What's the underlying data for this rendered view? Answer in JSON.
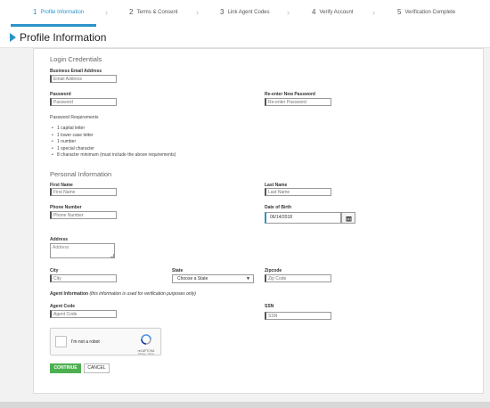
{
  "stepper": {
    "steps": [
      {
        "num": "1",
        "label": "Profile Information"
      },
      {
        "num": "2",
        "label": "Terms & Consent"
      },
      {
        "num": "3",
        "label": "Link Agent Codes"
      },
      {
        "num": "4",
        "label": "Verify Account"
      },
      {
        "num": "5",
        "label": "Verification Complete"
      }
    ],
    "separator": "›"
  },
  "page_title": "Profile Information",
  "login": {
    "title": "Login Credentials",
    "email_label": "Business Email Address",
    "email_placeholder": "Email Address",
    "password_label": "Password",
    "password_placeholder": "Password",
    "reenter_label": "Re-enter New Password",
    "reenter_placeholder": "Re-enter Password",
    "requirements_title": "Password Requirements",
    "requirements": [
      "1 capital letter",
      "1 lower case letter",
      "1 number",
      "1 special character",
      "8 character minimum (must include the above requirements)"
    ]
  },
  "personal": {
    "title": "Personal Information",
    "first_label": "First Name",
    "first_placeholder": "First Name",
    "last_label": "Last Name",
    "last_placeholder": "Last Name",
    "phone_label": "Phone Number",
    "phone_placeholder": "Phone Number",
    "dob_label": "Date of Birth",
    "dob_value": "06/14/2018",
    "address_label": "Address",
    "address_placeholder": "Address",
    "city_label": "City",
    "city_placeholder": "City",
    "state_label": "State",
    "state_selected": "Choose a State",
    "zip_label": "Zipcode",
    "zip_placeholder": "Zip Code",
    "agent_info_label": "Agent Information",
    "agent_info_note": "(this information is used for verification purposes only)",
    "agent_code_label": "Agent Code",
    "agent_code_placeholder": "Agent Code",
    "ssn_label": "SSN",
    "ssn_placeholder": "SSN"
  },
  "captcha": {
    "label": "I'm not a robot",
    "brand": "reCAPTCHA",
    "terms": "Privacy - Terms"
  },
  "buttons": {
    "continue": "CONTINUE",
    "cancel": "CANCEL"
  },
  "icons": {
    "title_marker": "chevron-right-icon",
    "calendar": "calendar-icon",
    "recaptcha": "recaptcha-icon"
  },
  "colors": {
    "accent": "#2a93c9",
    "continue_bg": "#4caf50"
  }
}
